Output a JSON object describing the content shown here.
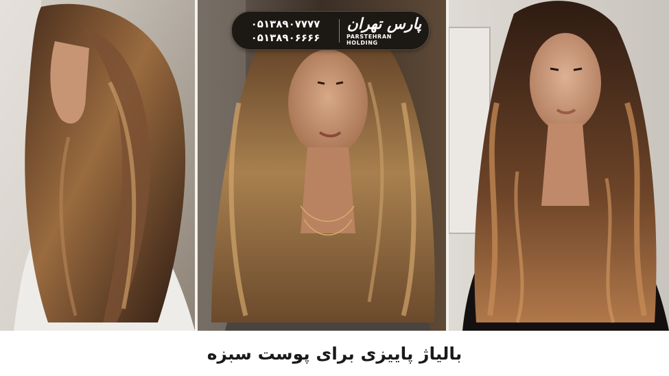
{
  "badge": {
    "phone_1": "۰۵۱۳۸۹۰۷۷۷۷",
    "phone_2": "۰۵۱۳۸۹۰۶۶۶۶",
    "brand_logo": "پارس تهران",
    "brand_name": "PARSTEHRAN HOLDING"
  },
  "caption": "بالیاژ پاییزی برای پوست سبزه",
  "colors": {
    "badge_bg": "#1c1814",
    "hair_dark": "#3a2418",
    "hair_highlight": "#b98a55",
    "skin": "#c99877",
    "caption_text": "#1a1a1a"
  }
}
